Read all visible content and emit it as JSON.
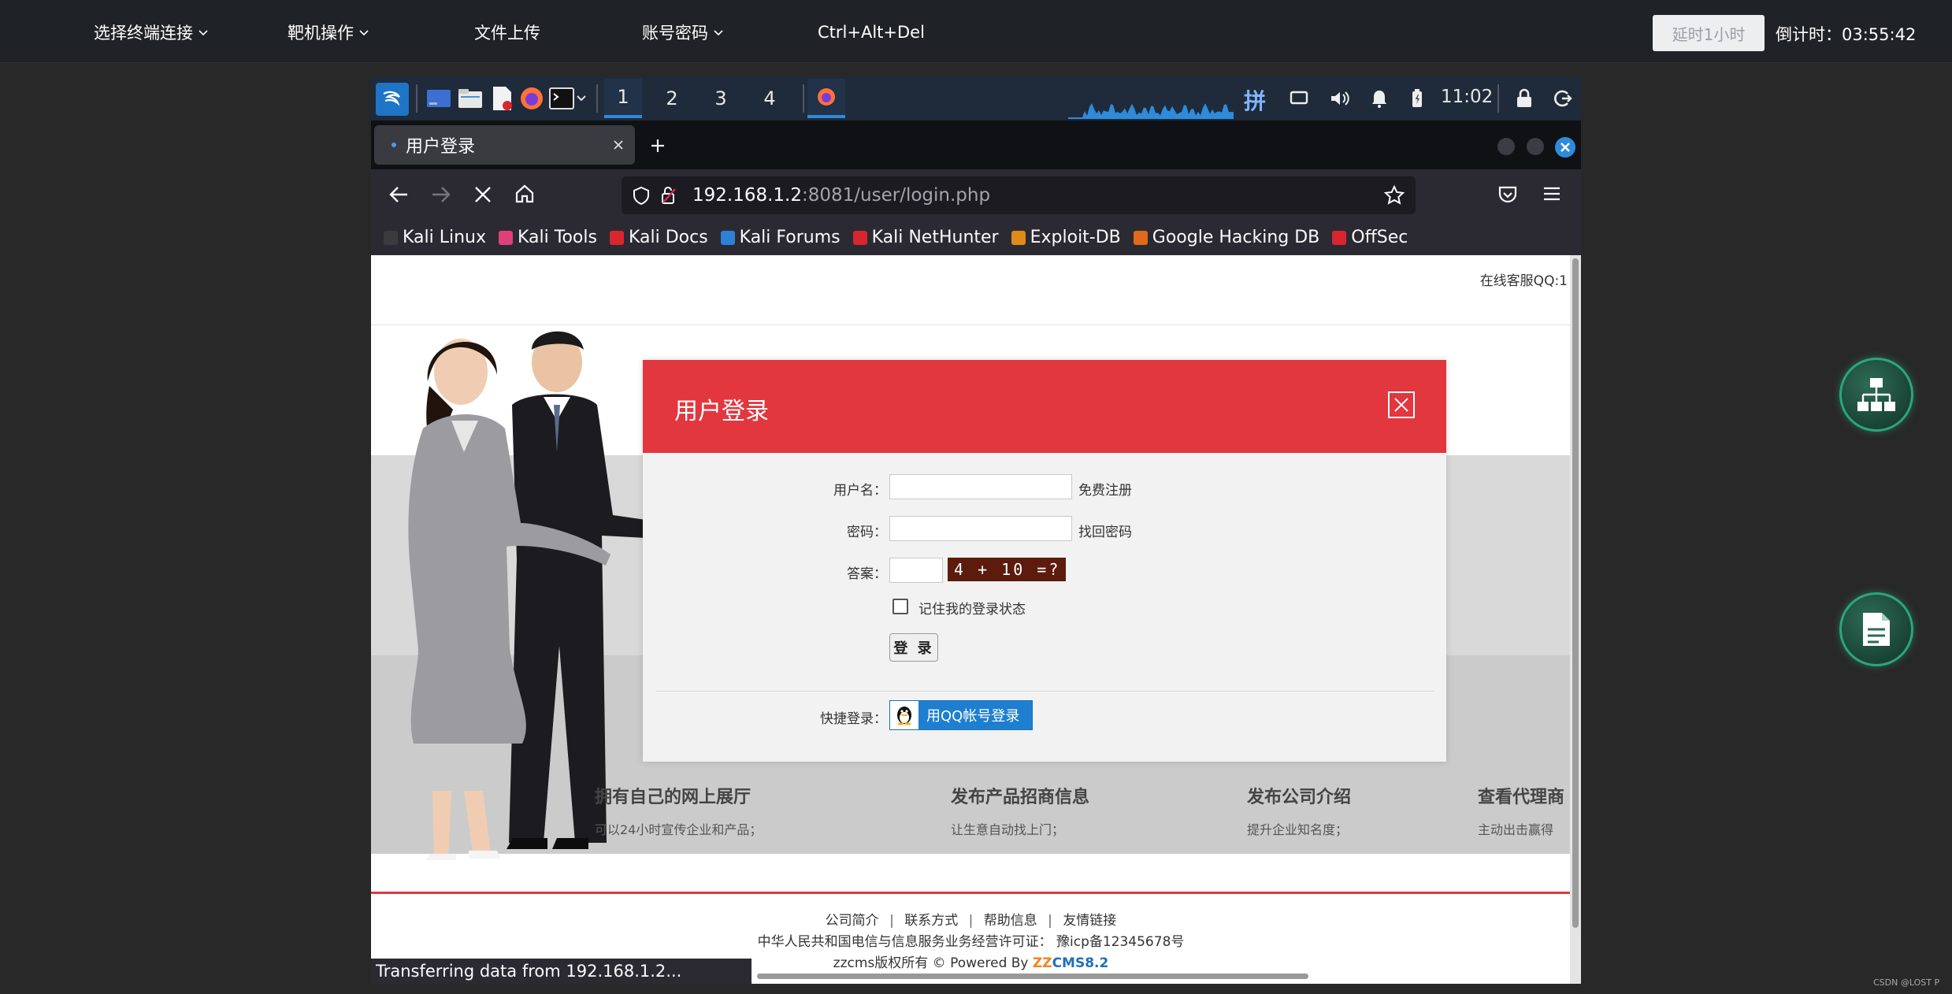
{
  "toolbar": {
    "menu_terminal": "选择终端连接",
    "menu_target": "靶机操作",
    "menu_upload": "文件上传",
    "menu_account": "账号密码",
    "menu_cad": "Ctrl+Alt+Del",
    "delay_button": "延时1小时",
    "countdown_label": "倒计时：",
    "countdown_value": "03:55:42"
  },
  "panel": {
    "workspaces": [
      "1",
      "2",
      "3",
      "4"
    ],
    "active_workspace": "1",
    "input_method": "拼",
    "clock": "11:02"
  },
  "browser": {
    "tab_title": "用户登录",
    "url_host": "192.168.1.2",
    "url_rest": ":8081/user/login.php",
    "bookmarks": [
      {
        "label": "Kali Linux",
        "color": "#3b3b3b"
      },
      {
        "label": "Kali Tools",
        "color": "#e0407a"
      },
      {
        "label": "Kali Docs",
        "color": "#d9262e"
      },
      {
        "label": "Kali Forums",
        "color": "#2f7fd7"
      },
      {
        "label": "Kali NetHunter",
        "color": "#d9262e"
      },
      {
        "label": "Exploit-DB",
        "color": "#e08a1a"
      },
      {
        "label": "Google Hacking DB",
        "color": "#e06a1a"
      },
      {
        "label": "OffSec",
        "color": "#d9262e"
      }
    ],
    "status": "Transferring data from 192.168.1.2..."
  },
  "page": {
    "qq_service": "在线客服QQ:1",
    "features": [
      {
        "title": "拥有自己的网上展厅",
        "desc": "可以24小时宣传企业和产品；"
      },
      {
        "title": "发布产品招商信息",
        "desc": "让生意自动找上门；"
      },
      {
        "title": "发布公司介绍",
        "desc": "提升企业知名度；"
      },
      {
        "title": "查看代理商",
        "desc": "主动出击赢得"
      }
    ],
    "footer_links": [
      "公司简介",
      "联系方式",
      "帮助信息",
      "友情链接"
    ],
    "footer_sep": "|",
    "icp": "中华人民共和国电信与信息服务业务经营许可证： 豫icp备12345678号",
    "copyright": "zzcms版权所有 © Powered By ",
    "powered_zz": "ZZ",
    "powered_cms": "CMS8.2"
  },
  "login": {
    "title": "用户登录",
    "username_label": "用户名：",
    "register_link": "免费注册",
    "password_label": "密码：",
    "forgot_link": "找回密码",
    "answer_label": "答案：",
    "captcha": "4 + 10 =?",
    "remember": "记住我的登录状态",
    "submit": "登 录",
    "quick_label": "快捷登录：",
    "qq_login": "用QQ帐号登录"
  },
  "watermark": "CSDN @LOST P",
  "colors": {
    "accent_red": "#e3373f",
    "fab_green": "#2ba57e",
    "qq_blue": "#1e7fd0"
  }
}
